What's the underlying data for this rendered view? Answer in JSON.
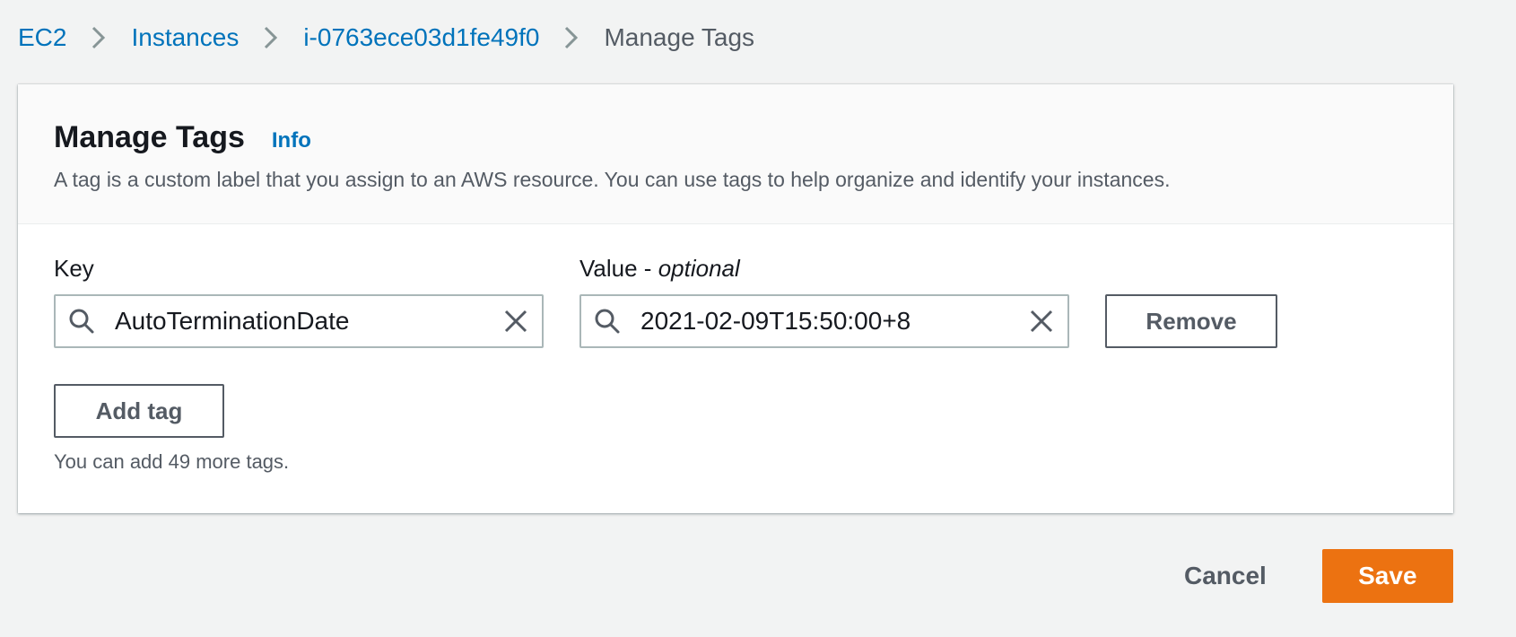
{
  "breadcrumb": {
    "items": [
      {
        "label": "EC2"
      },
      {
        "label": "Instances"
      },
      {
        "label": "i-0763ece03d1fe49f0"
      }
    ],
    "current": "Manage Tags"
  },
  "panel": {
    "title": "Manage Tags",
    "info_label": "Info",
    "description": "A tag is a custom label that you assign to an AWS resource. You can use tags to help organize and identify your instances."
  },
  "tag_form": {
    "key_label": "Key",
    "value_label_prefix": "Value - ",
    "value_label_optional": "optional",
    "key_value": "AutoTerminationDate",
    "value_value": "2021-02-09T15:50:00+8",
    "remove_label": "Remove",
    "add_tag_label": "Add tag",
    "hint": "You can add 49 more tags."
  },
  "actions": {
    "cancel_label": "Cancel",
    "save_label": "Save"
  },
  "colors": {
    "link": "#0073bb",
    "primary_button": "#ec7211",
    "text_secondary": "#545b64",
    "background": "#f2f3f3"
  },
  "icons": [
    "chevron-right-icon",
    "search-icon",
    "close-icon"
  ]
}
